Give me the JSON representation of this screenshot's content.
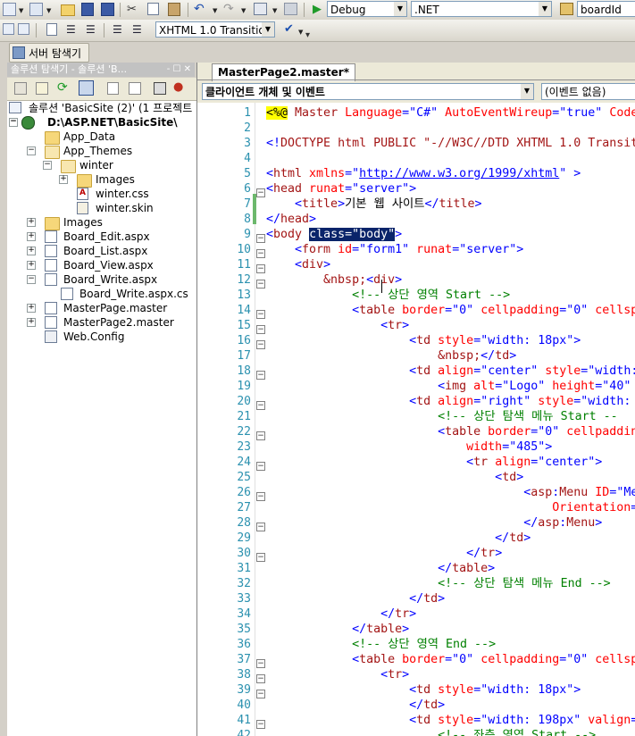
{
  "toolbar1": {
    "config_value": "Debug",
    "platform_value": ".NET",
    "find_value": "boardId"
  },
  "toolbar2": {
    "doctype_value": "XHTML 1.0 Transitio",
    "server_explorer_label": "서버 탐색기"
  },
  "solution_explorer": {
    "title": "솔루션 탐색기 - 솔루션 'B...",
    "title_icons": "- ☐ ✕",
    "items": [
      {
        "label": "솔루션 'BasicSite (2)' (1 프로젝트"
      },
      {
        "label": "D:\\ASP.NET\\BasicSite\\"
      },
      {
        "label": "App_Data"
      },
      {
        "label": "App_Themes"
      },
      {
        "label": "winter"
      },
      {
        "label": "Images"
      },
      {
        "label": "winter.css"
      },
      {
        "label": "winter.skin"
      },
      {
        "label": "Images"
      },
      {
        "label": "Board_Edit.aspx"
      },
      {
        "label": "Board_List.aspx"
      },
      {
        "label": "Board_View.aspx"
      },
      {
        "label": "Board_Write.aspx"
      },
      {
        "label": "Board_Write.aspx.cs"
      },
      {
        "label": "MasterPage.master"
      },
      {
        "label": "MasterPage2.master"
      },
      {
        "label": "Web.Config"
      }
    ]
  },
  "editor": {
    "tab_label": "MasterPage2.master*",
    "client_objects_value": "클라이언트 개체 및 이벤트",
    "events_value": "(이벤트 없음)",
    "line_numbers": [
      "1",
      "2",
      "3",
      "4",
      "5",
      "6",
      "7",
      "8",
      "9",
      "10",
      "11",
      "12",
      "13",
      "14",
      "15",
      "16",
      "17",
      "18",
      "19",
      "20",
      "21",
      "22",
      "23",
      "24",
      "25",
      "26",
      "27",
      "28",
      "29",
      "30",
      "31",
      "32",
      "33",
      "34",
      "35",
      "36",
      "37",
      "38",
      "39",
      "40",
      "41",
      "42"
    ],
    "lines": {
      "l1a": "<%@",
      "l1b": " Master ",
      "l1c": "Language",
      "l1d": "=\"C#\" ",
      "l1e": "AutoEventWireup",
      "l1f": "=\"true\" ",
      "l1g": "Code",
      "l3a": "<!",
      "l3b": "DOCTYPE",
      "l3c": " html PUBLIC \"-//W3C//DTD XHTML 1.0 Transit",
      "l5a": "<",
      "l5b": "html",
      "l5c": " xmlns",
      "l5d": "=\"",
      "l5e": "http://www.w3.org/1999/xhtml",
      "l5f": "\" >",
      "l6a": "<",
      "l6b": "head",
      "l6c": " runat",
      "l6d": "=\"server\">",
      "l7a": "    <",
      "l7b": "title",
      "l7c": ">",
      "l7d": "기본 웹 사이트",
      "l7e": "</",
      "l7f": "title",
      "l7g": ">",
      "l8a": "</",
      "l8b": "head",
      "l8c": ">",
      "l9a": "<",
      "l9b": "body",
      "l9c": " ",
      "l9d": "class=\"body\"",
      "l9e": ">",
      "l10a": "    <",
      "l10b": "form",
      "l10c": " id",
      "l10d": "=\"form1\" ",
      "l10e": "runat",
      "l10f": "=\"server\">",
      "l11a": "    <",
      "l11b": "div",
      "l11c": ">",
      "l12a": "        &nbsp;",
      "l12b": "<",
      "l12c": "div",
      "l12d": ">",
      "l13": "            <!-- 상단 영역 Start -->",
      "l14a": "            <",
      "l14b": "table",
      "l14c": " border",
      "l14d": "=\"0\" ",
      "l14e": "cellpadding",
      "l14f": "=\"0\" ",
      "l14g": "cellsp",
      "l15a": "                <",
      "l15b": "tr",
      "l15c": ">",
      "l16a": "                    <",
      "l16b": "td",
      "l16c": " style",
      "l16d": "=\"width: 18px\">",
      "l17a": "                        &nbsp;",
      "l17b": "</",
      "l17c": "td",
      "l17d": ">",
      "l18a": "                    <",
      "l18b": "td",
      "l18c": " align",
      "l18d": "=\"center\" ",
      "l18e": "style",
      "l18f": "=\"width:",
      "l19a": "                        <",
      "l19b": "img",
      "l19c": " alt",
      "l19d": "=\"Logo\" ",
      "l19e": "height",
      "l19f": "=\"40\"",
      "l20a": "                    <",
      "l20b": "td",
      "l20c": " align",
      "l20d": "=\"right\" ",
      "l20e": "style",
      "l20f": "=\"width:",
      "l21": "                        <!-- 상단 탐색 메뉴 Start --",
      "l22a": "                        <",
      "l22b": "table",
      "l22c": " border",
      "l22d": "=\"0\" ",
      "l22e": "cellpaddin",
      "l23a": "                            width",
      "l23b": "=\"485\">",
      "l24a": "                            <",
      "l24b": "tr",
      "l24c": " align",
      "l24d": "=\"center\">",
      "l25a": "                                <",
      "l25b": "td",
      "l25c": ">",
      "l26a": "                                    <",
      "l26b": "asp",
      "l26c": ":",
      "l26d": "Menu",
      "l26e": " ID",
      "l26f": "=\"Me",
      "l27a": "                                        Orientation",
      "l27b": "=",
      "l28a": "                                    </",
      "l28b": "asp",
      "l28c": ":",
      "l28d": "Menu",
      "l28e": ">",
      "l29a": "                                </",
      "l29b": "td",
      "l29c": ">",
      "l30a": "                            </",
      "l30b": "tr",
      "l30c": ">",
      "l31a": "                        </",
      "l31b": "table",
      "l31c": ">",
      "l32": "                        <!-- 상단 탐색 메뉴 End -->",
      "l33a": "                    </",
      "l33b": "td",
      "l33c": ">",
      "l34a": "                </",
      "l34b": "tr",
      "l34c": ">",
      "l35a": "            </",
      "l35b": "table",
      "l35c": ">",
      "l36": "            <!-- 상단 영역 End -->",
      "l37a": "            <",
      "l37b": "table",
      "l37c": " border",
      "l37d": "=\"0\" ",
      "l37e": "cellpadding",
      "l37f": "=\"0\" ",
      "l37g": "cellsp",
      "l38a": "                <",
      "l38b": "tr",
      "l38c": ">",
      "l39a": "                    <",
      "l39b": "td",
      "l39c": " style",
      "l39d": "=\"width: 18px\">",
      "l40a": "                    </",
      "l40b": "td",
      "l40c": ">",
      "l41a": "                    <",
      "l41b": "td",
      "l41c": " style",
      "l41d": "=\"width: 198px\" ",
      "l41e": "valign",
      "l41f": "=",
      "l42": "                        <!-- 좌측 영역 Start -->"
    }
  }
}
